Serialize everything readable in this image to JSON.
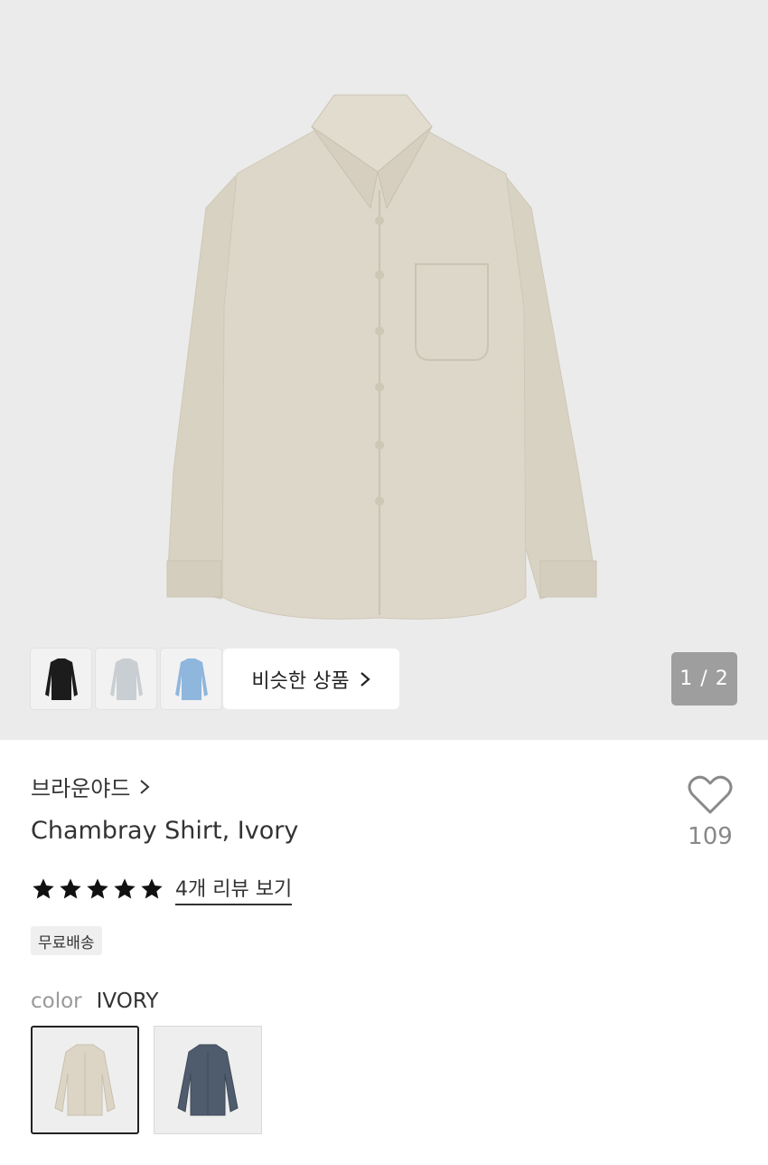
{
  "gallery": {
    "thumbnails": [
      {
        "name": "black shirt",
        "color": "#1c1c1c"
      },
      {
        "name": "light gray shirt",
        "color": "#c9ced2"
      },
      {
        "name": "blue shirt",
        "color": "#8fb6dc"
      }
    ],
    "similar_label": "비슷한 상품",
    "pager": "1 / 2",
    "main_color": "#dcd6c8"
  },
  "product": {
    "brand": "브라운야드",
    "title": "Chambray Shirt, Ivory",
    "rating": 5,
    "review_link": "4개 리뷰 보기",
    "badge": "무료배송",
    "likes": "109"
  },
  "color_option": {
    "label": "color",
    "value": "IVORY",
    "swatches": [
      {
        "name": "ivory",
        "color": "#dcd5c6",
        "selected": true
      },
      {
        "name": "navy",
        "color": "#4f5c6e",
        "selected": false
      }
    ]
  }
}
